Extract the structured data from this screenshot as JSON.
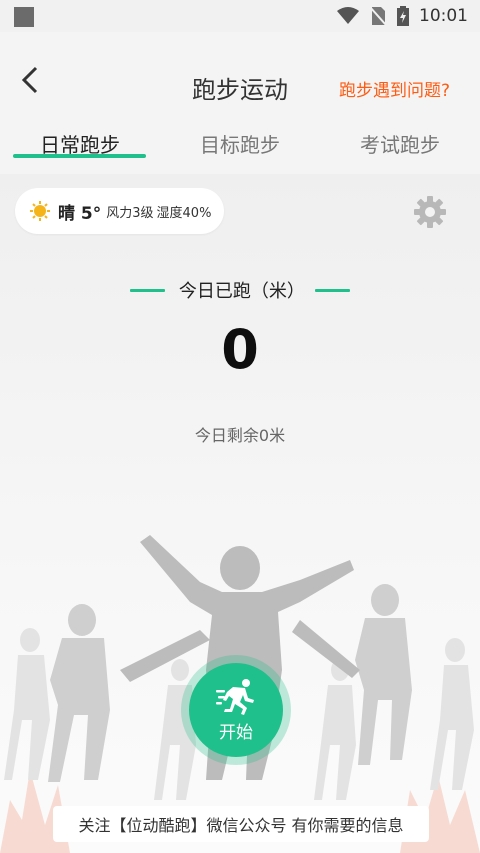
{
  "status_bar": {
    "time": "10:01"
  },
  "header": {
    "title": "跑步运动",
    "problem_link": "跑步遇到问题?"
  },
  "tabs": [
    {
      "label": "日常跑步",
      "active": true
    },
    {
      "label": "目标跑步",
      "active": false
    },
    {
      "label": "考试跑步",
      "active": false
    }
  ],
  "weather": {
    "desc": "晴 5°",
    "wind": "风力3级",
    "humidity": "湿度40%"
  },
  "today": {
    "label": "今日已跑（米）",
    "distance": "0",
    "remaining": "今日剩余0米"
  },
  "start_button": {
    "label": "开始"
  },
  "footer": {
    "text": "关注【位动酷跑】微信公众号 有你需要的信息"
  },
  "colors": {
    "accent": "#1fc08b",
    "link": "#ff5b12"
  }
}
